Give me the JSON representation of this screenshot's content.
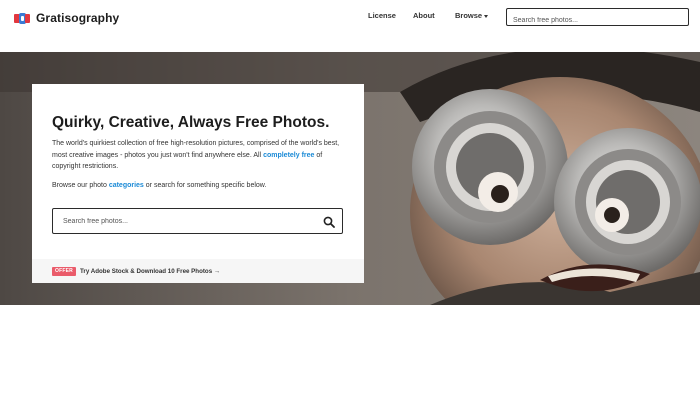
{
  "header": {
    "logo_text": "Gratisography",
    "nav": {
      "license": "License",
      "about": "About",
      "browse": "Browse"
    },
    "search_placeholder": "Search free photos..."
  },
  "hero": {
    "title": "Quirky, Creative, Always Free Photos.",
    "description_before_link": "The world's quirkiest collection of free high-resolution pictures, comprised of the world's best, most creative images - photos you just won't find anywhere else. All ",
    "description_link": "completely free",
    "description_after_link": " of copyright restrictions.",
    "browse_before_link": "Browse our photo ",
    "browse_link": "categories",
    "browse_after_link": " or search for something specific below.",
    "search_placeholder": "Search free photos...",
    "offer_badge": "OFFER",
    "offer_text": "Try Adobe Stock & Download 10 Free Photos",
    "offer_arrow": "→"
  },
  "colors": {
    "accent_link": "#1b8ad6",
    "offer_badge": "#ea5b6a",
    "logo_red": "#e2383f",
    "logo_blue": "#3b7bd4"
  }
}
